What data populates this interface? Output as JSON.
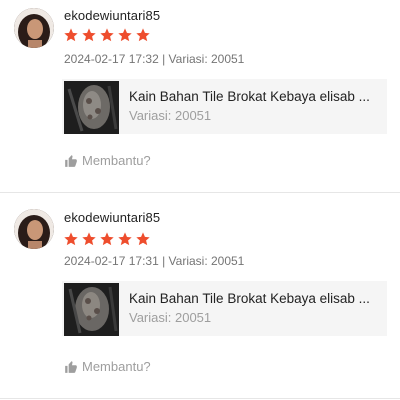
{
  "reviews": [
    {
      "username": "ekodewiuntari85",
      "rating": 5,
      "meta": "2024-02-17 17:32 | Variasi: 20051",
      "product_title": "Kain Bahan Tile Brokat Kebaya elisab ...",
      "product_variant": "Variasi: 20051",
      "helpful_label": "Membantu?"
    },
    {
      "username": "ekodewiuntari85",
      "rating": 5,
      "meta": "2024-02-17 17:31 | Variasi: 20051",
      "product_title": "Kain Bahan Tile Brokat Kebaya elisab ...",
      "product_variant": "Variasi: 20051",
      "helpful_label": "Membantu?"
    }
  ],
  "colors": {
    "star": "#ee4d2d",
    "muted_text": "#9e9e9e",
    "card_bg": "#f5f5f5"
  },
  "icons": {
    "star": "star-icon",
    "helpful": "thumbs-up-icon"
  }
}
